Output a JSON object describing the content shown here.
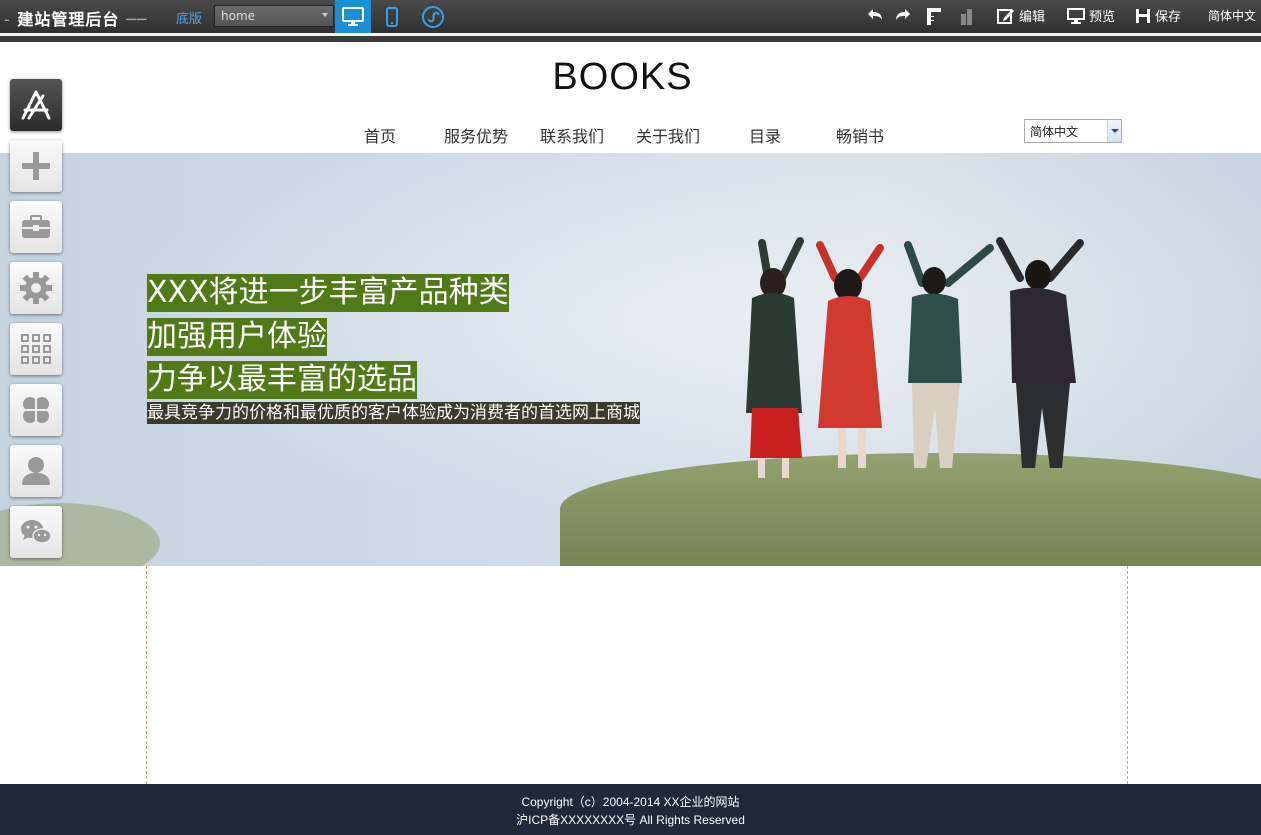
{
  "toolbar": {
    "title": "建站管理后台",
    "base_label": "底版",
    "page_select_value": "home",
    "undo_icon": "undo-icon",
    "redo_icon": "redo-icon",
    "edit_label": "编辑",
    "preview_label": "预览",
    "save_label": "保存",
    "language_label": "简体中文",
    "active_color": "#1a8fd6"
  },
  "sidebar": {
    "buttons": [
      "app-store-icon",
      "plus-icon",
      "toolbox-icon",
      "gear-icon",
      "grid-icon",
      "clover-icon",
      "user-icon",
      "wechat-icon"
    ]
  },
  "site": {
    "logo": "BOOKS",
    "nav": [
      "首页",
      "服务优势",
      "联系我们",
      "关于我们",
      "目录",
      "畅销书"
    ],
    "language_select": "简体中文"
  },
  "banner": {
    "slogans": [
      "XXX将进一步丰富产品种类",
      "加强用户体验",
      "力争以最丰富的选品"
    ],
    "subtitle": "最具竞争力的价格和最优质的客户体验成为消费者的首选网上商城",
    "highlight_color": "#4f7a17"
  },
  "footer": {
    "copyright": "Copyright（c）2004-2014  XX企业的网站",
    "icp": "沪ICP备XXXXXXXX号 All Rights Reserved",
    "background": "#20283a"
  }
}
